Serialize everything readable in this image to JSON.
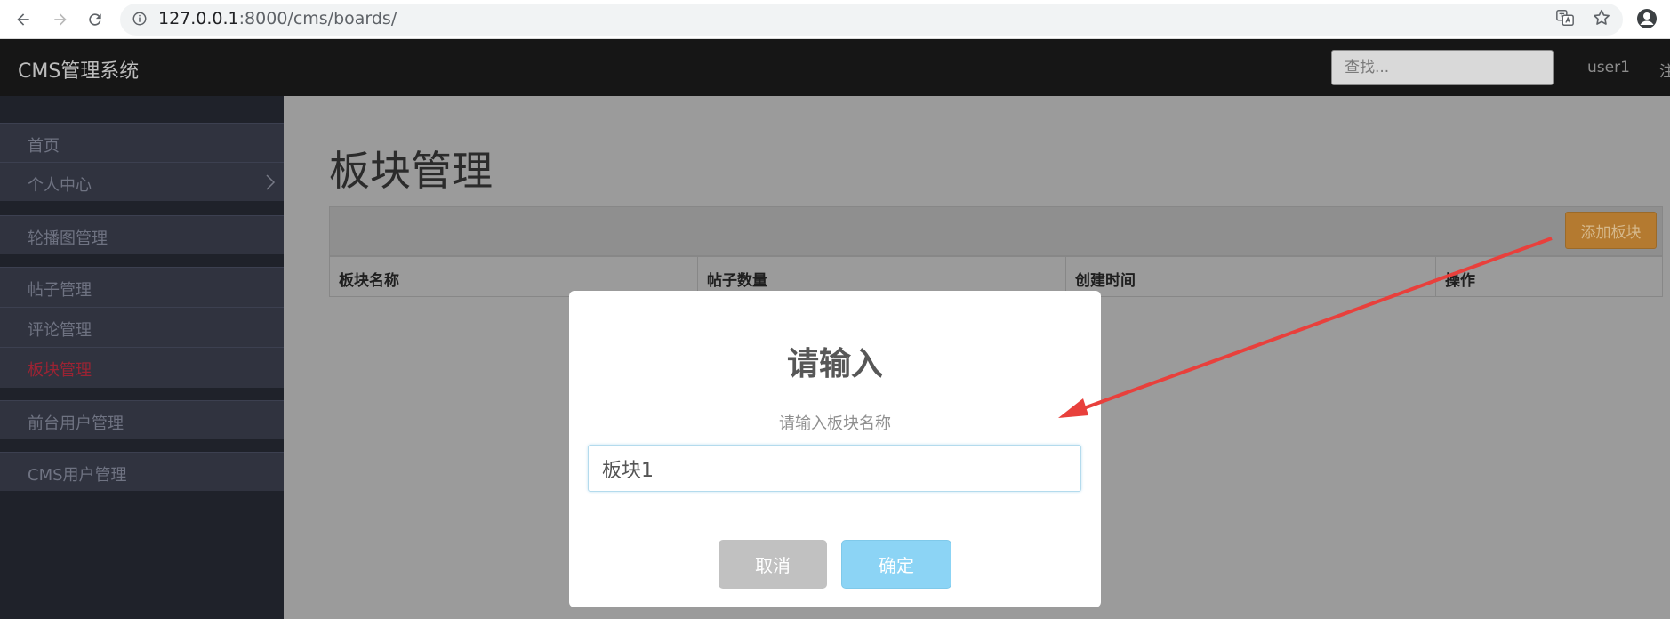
{
  "browser": {
    "url_host": "127.0.0.1",
    "url_rest": ":8000/cms/boards/"
  },
  "header": {
    "brand": "CMS管理系统",
    "search_placeholder": "查找...",
    "user": "user1",
    "logout": "注"
  },
  "sidebar": {
    "items": [
      {
        "label": "首页"
      },
      {
        "label": "个人中心"
      },
      {
        "label": "轮播图管理"
      },
      {
        "label": "帖子管理"
      },
      {
        "label": "评论管理"
      },
      {
        "label": "板块管理",
        "active": true
      },
      {
        "label": "前台用户管理"
      },
      {
        "label": "CMS用户管理"
      }
    ]
  },
  "main": {
    "title": "板块管理",
    "add_button": "添加板块",
    "table_headers": [
      "板块名称",
      "帖子数量",
      "创建时间",
      "操作"
    ]
  },
  "modal": {
    "title": "请输入",
    "subtitle": "请输入板块名称",
    "input_value": "板块1",
    "cancel": "取消",
    "confirm": "确定"
  },
  "colors": {
    "active_item": "#9c2333",
    "add_button": "#b47a30",
    "confirm_button": "#8cd4f5",
    "annotation_arrow": "#e8403c"
  }
}
